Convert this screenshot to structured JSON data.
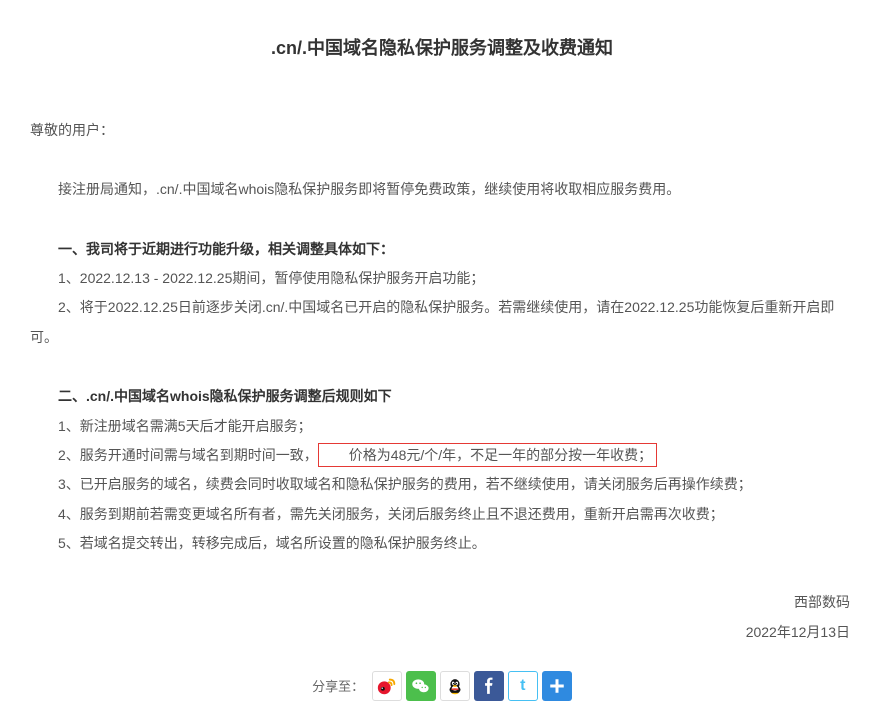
{
  "title": ".cn/.中国域名隐私保护服务调整及收费通知",
  "greeting": "尊敬的用户：",
  "intro": "接注册局通知，.cn/.中国域名whois隐私保护服务即将暂停免费政策，继续使用将收取相应服务费用。",
  "section1": {
    "head": "一、我司将于近期进行功能升级，相关调整具体如下：",
    "items": [
      "1、2022.12.13 - 2022.12.25期间，暂停使用隐私保护服务开启功能；",
      "2、将于2022.12.25日前逐步关闭.cn/.中国域名已开启的隐私保护服务。若需继续使用，请在2022.12.25功能恢复后重新开启即可。"
    ]
  },
  "section2": {
    "head": "二、.cn/.中国域名whois隐私保护服务调整后规则如下",
    "items_before_highlight": [
      "1、新注册域名需满5天后才能开启服务；"
    ],
    "item2_prefix": "2、服务开通时间需与域名到期时间一致，",
    "item2_highlight": "价格为48元/个/年，不足一年的部分按一年收费；",
    "items_after_highlight": [
      "3、已开启服务的域名，续费会同时收取域名和隐私保护服务的费用，若不继续使用，请关闭服务后再操作续费；",
      "4、服务到期前若需变更域名所有者，需先关闭服务，关闭后服务终止且不退还费用，重新开启需再次收费；",
      "5、若域名提交转出，转移完成后，域名所设置的隐私保护服务终止。"
    ]
  },
  "signer": "西部数码",
  "date": "2022年12月13日",
  "share_label": "分享至：",
  "share": {
    "weibo": "sina-weibo-icon",
    "wechat": "wechat-icon",
    "qq": "qq-icon",
    "facebook": "facebook-icon",
    "twitter": "twitter-icon",
    "more": "more-share-icon"
  }
}
